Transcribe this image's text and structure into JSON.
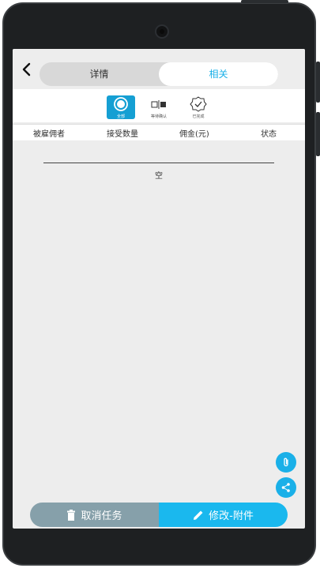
{
  "header": {
    "back_icon": "chevron-left-icon",
    "tabs": [
      {
        "label": "详情",
        "active": false
      },
      {
        "label": "相关",
        "active": true
      }
    ]
  },
  "filters": [
    {
      "label": "全部",
      "icon": "circle-all-icon",
      "active": true
    },
    {
      "label": "等待确认",
      "icon": "toggle-pending-icon",
      "active": false
    },
    {
      "label": "已完成",
      "icon": "check-badge-icon",
      "active": false
    }
  ],
  "table": {
    "columns": [
      "被雇佣者",
      "接受数量",
      "佣金(元)",
      "状态"
    ],
    "rows": [],
    "empty_text": "空"
  },
  "fabs": [
    {
      "icon": "attachment-icon"
    },
    {
      "icon": "share-icon"
    }
  ],
  "actions": {
    "cancel_label": "取消任务",
    "cancel_icon": "trash-icon",
    "edit_label": "修改-附件",
    "edit_icon": "pencil-icon"
  },
  "colors": {
    "accent": "#1ab0e8",
    "cancel_button": "#86a0aa",
    "screen_bg": "#ededed",
    "device_frame": "#1e2022"
  }
}
